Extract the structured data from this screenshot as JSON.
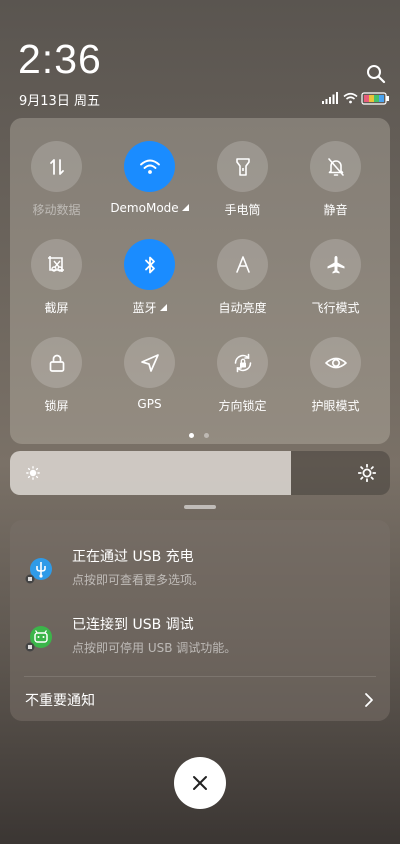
{
  "status": {
    "time": "2:36",
    "date": "9月13日 周五"
  },
  "quick_settings": {
    "tiles": [
      {
        "label": "移动数据",
        "icon": "mobile-data-icon",
        "active": false,
        "dim": true
      },
      {
        "label": "DemoMode",
        "icon": "wifi-icon",
        "active": true,
        "expand": true
      },
      {
        "label": "手电筒",
        "icon": "flashlight-icon",
        "active": false
      },
      {
        "label": "静音",
        "icon": "mute-bell-icon",
        "active": false
      },
      {
        "label": "截屏",
        "icon": "screenshot-icon",
        "active": false
      },
      {
        "label": "蓝牙",
        "icon": "bluetooth-icon",
        "active": true,
        "expand": true
      },
      {
        "label": "自动亮度",
        "icon": "auto-brightness-icon",
        "active": false
      },
      {
        "label": "飞行模式",
        "icon": "airplane-icon",
        "active": false
      },
      {
        "label": "锁屏",
        "icon": "lock-icon",
        "active": false
      },
      {
        "label": "GPS",
        "icon": "gps-icon",
        "active": false
      },
      {
        "label": "方向锁定",
        "icon": "rotation-lock-icon",
        "active": false
      },
      {
        "label": "护眼模式",
        "icon": "eye-icon",
        "active": false
      }
    ],
    "page_count": 2,
    "current_page": 1
  },
  "brightness": {
    "level": 0.74
  },
  "notifications": [
    {
      "title": "正在通过 USB 充电",
      "subtitle": "点按即可查看更多选项。",
      "icon": "usb-icon",
      "icon_color": "#2f9be8"
    },
    {
      "title": "已连接到 USB 调试",
      "subtitle": "点按即可停用 USB 调试功能。",
      "icon": "android-debug-icon",
      "icon_color": "#3bb54a"
    }
  ],
  "unimportant_label": "不重要通知",
  "colors": {
    "accent": "#1a8cff",
    "battery_fill": "#e85d7a"
  }
}
